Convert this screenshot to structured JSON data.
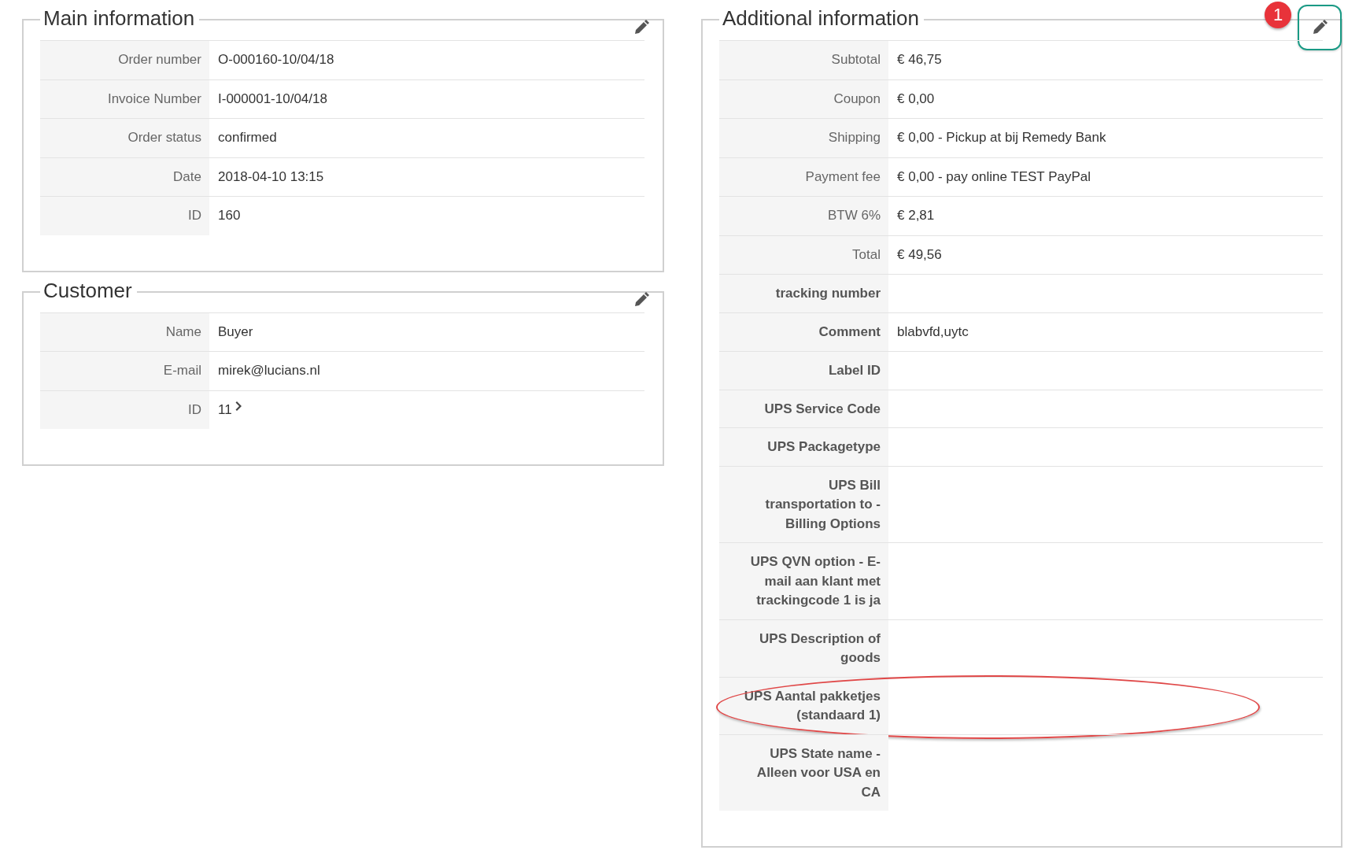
{
  "columns": [
    {
      "sections": [
        {
          "title": "Main information",
          "edit_highlighted": false,
          "rows": [
            {
              "label": "Order number",
              "value": "O-000160-10/04/18",
              "kind": "plain",
              "circled": false,
              "chevron": false
            },
            {
              "label": "Invoice Number",
              "value": "I-000001-10/04/18",
              "kind": "plain",
              "circled": false,
              "chevron": false
            },
            {
              "label": "Order status",
              "value": "confirmed",
              "kind": "plain",
              "circled": false,
              "chevron": false
            },
            {
              "label": "Date",
              "value": "2018-04-10 13:15",
              "kind": "plain",
              "circled": false,
              "chevron": false
            },
            {
              "label": "ID",
              "value": "160",
              "kind": "plain",
              "circled": false,
              "chevron": false
            }
          ]
        },
        {
          "title": "Customer",
          "edit_highlighted": false,
          "rows": [
            {
              "label": "Name",
              "value": "Buyer",
              "kind": "plain",
              "circled": false,
              "chevron": false
            },
            {
              "label": "E-mail",
              "value": "mirek@lucians.nl",
              "kind": "plain",
              "circled": false,
              "chevron": false
            },
            {
              "label": "ID",
              "value": "11",
              "kind": "plain",
              "circled": false,
              "chevron": true
            }
          ]
        }
      ]
    },
    {
      "sections": [
        {
          "title": "Additional information",
          "edit_highlighted": true,
          "badge": "1",
          "rows": [
            {
              "label": "Subtotal",
              "value": "€ 46,75",
              "kind": "plain",
              "circled": false,
              "chevron": false
            },
            {
              "label": "Coupon",
              "value": "€ 0,00",
              "kind": "plain",
              "circled": false,
              "chevron": false
            },
            {
              "label": "Shipping",
              "value": "€ 0,00 - Pickup at bij Remedy Bank",
              "kind": "plain",
              "circled": false,
              "chevron": false
            },
            {
              "label": "Payment fee",
              "value": "€ 0,00 - pay online TEST PayPal",
              "kind": "plain",
              "circled": false,
              "chevron": false
            },
            {
              "label": "BTW 6%",
              "value": "€ 2,81",
              "kind": "plain",
              "circled": false,
              "chevron": false
            },
            {
              "label": "Total",
              "value": "€ 49,56",
              "kind": "plain",
              "circled": false,
              "chevron": false
            },
            {
              "label": "tracking number",
              "kind": "custom",
              "circled": false,
              "chevron": false
            },
            {
              "label": "Comment",
              "value": "blabvfd,uytc",
              "kind": "custom",
              "circled": false,
              "chevron": false
            },
            {
              "label": "Label ID",
              "kind": "custom",
              "circled": false,
              "chevron": false
            },
            {
              "label": "UPS Service Code",
              "kind": "custom",
              "circled": false,
              "chevron": false
            },
            {
              "label": "UPS Packagetype",
              "kind": "custom",
              "circled": false,
              "chevron": false
            },
            {
              "label": "UPS Bill transportation to - Billing Options",
              "kind": "custom",
              "circled": false,
              "chevron": false
            },
            {
              "label": "UPS QVN option - E-mail aan klant met trackingcode 1 is ja",
              "kind": "custom",
              "circled": false,
              "chevron": false
            },
            {
              "label": "UPS Description of goods",
              "kind": "custom",
              "circled": false,
              "chevron": false
            },
            {
              "label": "UPS Aantal pakketjes (standaard 1)",
              "kind": "custom",
              "circled": true,
              "chevron": false
            },
            {
              "label": "UPS State name - Alleen voor USA en CA",
              "kind": "custom",
              "circled": false,
              "chevron": false
            }
          ]
        }
      ]
    }
  ]
}
